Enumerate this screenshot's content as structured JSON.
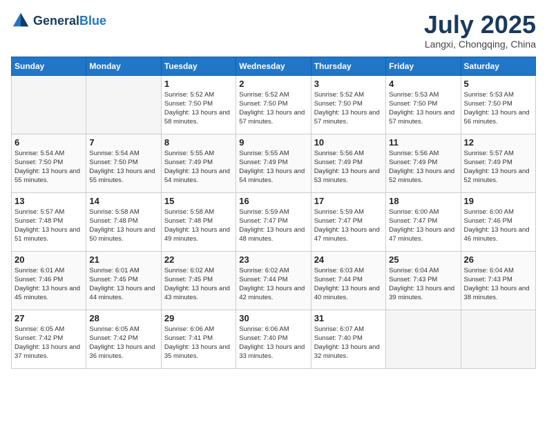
{
  "header": {
    "logo": {
      "general": "General",
      "blue": "Blue"
    },
    "title": "July 2025",
    "location": "Langxi, Chongqing, China"
  },
  "days_of_week": [
    "Sunday",
    "Monday",
    "Tuesday",
    "Wednesday",
    "Thursday",
    "Friday",
    "Saturday"
  ],
  "weeks": [
    [
      {
        "day": "",
        "empty": true
      },
      {
        "day": "",
        "empty": true
      },
      {
        "day": "1",
        "sunrise": "Sunrise: 5:52 AM",
        "sunset": "Sunset: 7:50 PM",
        "daylight": "Daylight: 13 hours and 58 minutes."
      },
      {
        "day": "2",
        "sunrise": "Sunrise: 5:52 AM",
        "sunset": "Sunset: 7:50 PM",
        "daylight": "Daylight: 13 hours and 57 minutes."
      },
      {
        "day": "3",
        "sunrise": "Sunrise: 5:52 AM",
        "sunset": "Sunset: 7:50 PM",
        "daylight": "Daylight: 13 hours and 57 minutes."
      },
      {
        "day": "4",
        "sunrise": "Sunrise: 5:53 AM",
        "sunset": "Sunset: 7:50 PM",
        "daylight": "Daylight: 13 hours and 57 minutes."
      },
      {
        "day": "5",
        "sunrise": "Sunrise: 5:53 AM",
        "sunset": "Sunset: 7:50 PM",
        "daylight": "Daylight: 13 hours and 56 minutes."
      }
    ],
    [
      {
        "day": "6",
        "sunrise": "Sunrise: 5:54 AM",
        "sunset": "Sunset: 7:50 PM",
        "daylight": "Daylight: 13 hours and 55 minutes."
      },
      {
        "day": "7",
        "sunrise": "Sunrise: 5:54 AM",
        "sunset": "Sunset: 7:50 PM",
        "daylight": "Daylight: 13 hours and 55 minutes."
      },
      {
        "day": "8",
        "sunrise": "Sunrise: 5:55 AM",
        "sunset": "Sunset: 7:49 PM",
        "daylight": "Daylight: 13 hours and 54 minutes."
      },
      {
        "day": "9",
        "sunrise": "Sunrise: 5:55 AM",
        "sunset": "Sunset: 7:49 PM",
        "daylight": "Daylight: 13 hours and 54 minutes."
      },
      {
        "day": "10",
        "sunrise": "Sunrise: 5:56 AM",
        "sunset": "Sunset: 7:49 PM",
        "daylight": "Daylight: 13 hours and 53 minutes."
      },
      {
        "day": "11",
        "sunrise": "Sunrise: 5:56 AM",
        "sunset": "Sunset: 7:49 PM",
        "daylight": "Daylight: 13 hours and 52 minutes."
      },
      {
        "day": "12",
        "sunrise": "Sunrise: 5:57 AM",
        "sunset": "Sunset: 7:49 PM",
        "daylight": "Daylight: 13 hours and 52 minutes."
      }
    ],
    [
      {
        "day": "13",
        "sunrise": "Sunrise: 5:57 AM",
        "sunset": "Sunset: 7:48 PM",
        "daylight": "Daylight: 13 hours and 51 minutes."
      },
      {
        "day": "14",
        "sunrise": "Sunrise: 5:58 AM",
        "sunset": "Sunset: 7:48 PM",
        "daylight": "Daylight: 13 hours and 50 minutes."
      },
      {
        "day": "15",
        "sunrise": "Sunrise: 5:58 AM",
        "sunset": "Sunset: 7:48 PM",
        "daylight": "Daylight: 13 hours and 49 minutes."
      },
      {
        "day": "16",
        "sunrise": "Sunrise: 5:59 AM",
        "sunset": "Sunset: 7:47 PM",
        "daylight": "Daylight: 13 hours and 48 minutes."
      },
      {
        "day": "17",
        "sunrise": "Sunrise: 5:59 AM",
        "sunset": "Sunset: 7:47 PM",
        "daylight": "Daylight: 13 hours and 47 minutes."
      },
      {
        "day": "18",
        "sunrise": "Sunrise: 6:00 AM",
        "sunset": "Sunset: 7:47 PM",
        "daylight": "Daylight: 13 hours and 47 minutes."
      },
      {
        "day": "19",
        "sunrise": "Sunrise: 6:00 AM",
        "sunset": "Sunset: 7:46 PM",
        "daylight": "Daylight: 13 hours and 46 minutes."
      }
    ],
    [
      {
        "day": "20",
        "sunrise": "Sunrise: 6:01 AM",
        "sunset": "Sunset: 7:46 PM",
        "daylight": "Daylight: 13 hours and 45 minutes."
      },
      {
        "day": "21",
        "sunrise": "Sunrise: 6:01 AM",
        "sunset": "Sunset: 7:45 PM",
        "daylight": "Daylight: 13 hours and 44 minutes."
      },
      {
        "day": "22",
        "sunrise": "Sunrise: 6:02 AM",
        "sunset": "Sunset: 7:45 PM",
        "daylight": "Daylight: 13 hours and 43 minutes."
      },
      {
        "day": "23",
        "sunrise": "Sunrise: 6:02 AM",
        "sunset": "Sunset: 7:44 PM",
        "daylight": "Daylight: 13 hours and 42 minutes."
      },
      {
        "day": "24",
        "sunrise": "Sunrise: 6:03 AM",
        "sunset": "Sunset: 7:44 PM",
        "daylight": "Daylight: 13 hours and 40 minutes."
      },
      {
        "day": "25",
        "sunrise": "Sunrise: 6:04 AM",
        "sunset": "Sunset: 7:43 PM",
        "daylight": "Daylight: 13 hours and 39 minutes."
      },
      {
        "day": "26",
        "sunrise": "Sunrise: 6:04 AM",
        "sunset": "Sunset: 7:43 PM",
        "daylight": "Daylight: 13 hours and 38 minutes."
      }
    ],
    [
      {
        "day": "27",
        "sunrise": "Sunrise: 6:05 AM",
        "sunset": "Sunset: 7:42 PM",
        "daylight": "Daylight: 13 hours and 37 minutes."
      },
      {
        "day": "28",
        "sunrise": "Sunrise: 6:05 AM",
        "sunset": "Sunset: 7:42 PM",
        "daylight": "Daylight: 13 hours and 36 minutes."
      },
      {
        "day": "29",
        "sunrise": "Sunrise: 6:06 AM",
        "sunset": "Sunset: 7:41 PM",
        "daylight": "Daylight: 13 hours and 35 minutes."
      },
      {
        "day": "30",
        "sunrise": "Sunrise: 6:06 AM",
        "sunset": "Sunset: 7:40 PM",
        "daylight": "Daylight: 13 hours and 33 minutes."
      },
      {
        "day": "31",
        "sunrise": "Sunrise: 6:07 AM",
        "sunset": "Sunset: 7:40 PM",
        "daylight": "Daylight: 13 hours and 32 minutes."
      },
      {
        "day": "",
        "empty": true
      },
      {
        "day": "",
        "empty": true
      }
    ]
  ]
}
